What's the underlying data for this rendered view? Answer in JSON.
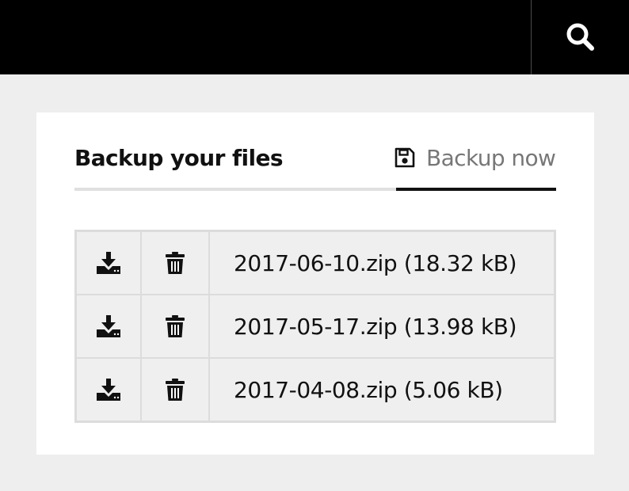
{
  "topbar": {
    "search_icon": "search-icon"
  },
  "card": {
    "title": "Backup your files",
    "backup_button": {
      "label": "Backup now",
      "icon": "save-icon"
    }
  },
  "files": [
    {
      "name": "2017-06-10.zip (18.32 kB)",
      "download_icon": "download-icon",
      "delete_icon": "trash-icon"
    },
    {
      "name": "2017-05-17.zip (13.98 kB)",
      "download_icon": "download-icon",
      "delete_icon": "trash-icon"
    },
    {
      "name": "2017-04-08.zip (5.06 kB)",
      "download_icon": "download-icon",
      "delete_icon": "trash-icon"
    }
  ],
  "colors": {
    "topbar": "#000000",
    "page_background": "#eeeeee",
    "card_background": "#ffffff",
    "table_background": "#efefef",
    "muted_text": "#777777"
  }
}
